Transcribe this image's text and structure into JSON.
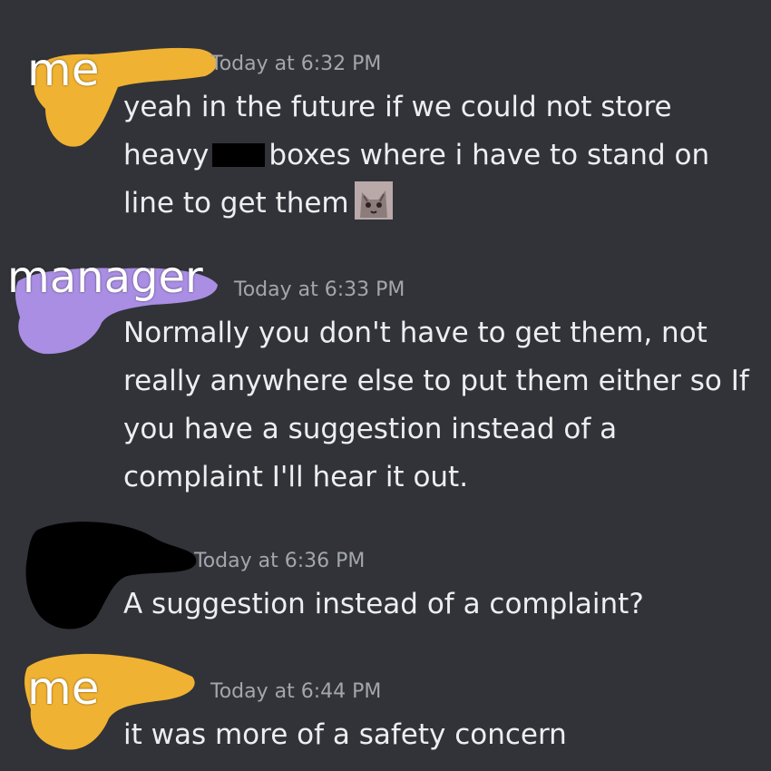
{
  "colors": {
    "background": "#313338",
    "timestamp": "#a3a6ad",
    "message_text": "#eceef0",
    "me_highlight": "#f0b232",
    "manager_highlight": "#a98ee3",
    "redaction": "#000000"
  },
  "messages": [
    {
      "author_label": "me",
      "timestamp": "Today at 6:32 PM",
      "lines": [
        "yeah in the future if we could not store",
        "heavy",
        "boxes where i have to stand on",
        "line to get them"
      ],
      "emoji": "cat-sticker-icon"
    },
    {
      "author_label": "manager",
      "timestamp": "Today at 6:33 PM",
      "lines": [
        "Normally you don't have to get them, not",
        "really anywhere else to put them either so If",
        "you have a suggestion instead of a",
        "complaint I'll hear it out."
      ]
    },
    {
      "author_label": "",
      "timestamp": "Today at 6:36 PM",
      "lines": [
        "A suggestion instead of a complaint?"
      ]
    },
    {
      "author_label": "me",
      "timestamp": "Today at 6:44 PM",
      "lines": [
        "it was more of a safety concern"
      ]
    }
  ]
}
